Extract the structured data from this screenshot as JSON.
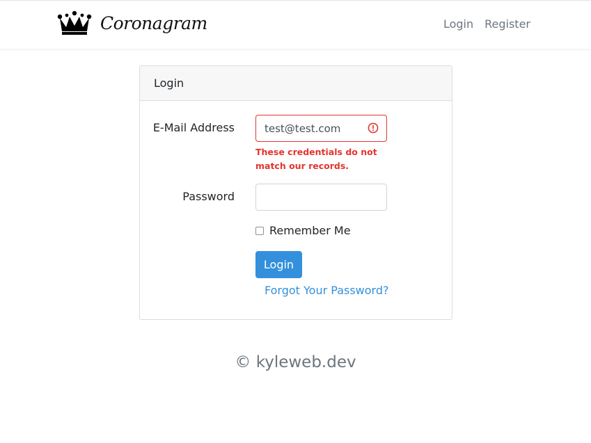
{
  "brand": {
    "name": "Coronagram",
    "logo_icon": "crown-icon"
  },
  "nav": {
    "login_label": "Login",
    "register_label": "Register"
  },
  "card": {
    "title": "Login"
  },
  "form": {
    "email_label": "E-Mail Address",
    "email_value": "test@test.com",
    "email_error": "These credentials do not match our records.",
    "password_label": "Password",
    "password_value": "",
    "remember_label": "Remember Me",
    "remember_checked": false,
    "submit_label": "Login",
    "forgot_label": "Forgot Your Password?"
  },
  "footer": {
    "text": "© kyleweb.dev"
  },
  "colors": {
    "primary": "#3490dc",
    "danger": "#e3342f",
    "muted": "#6c757d"
  }
}
